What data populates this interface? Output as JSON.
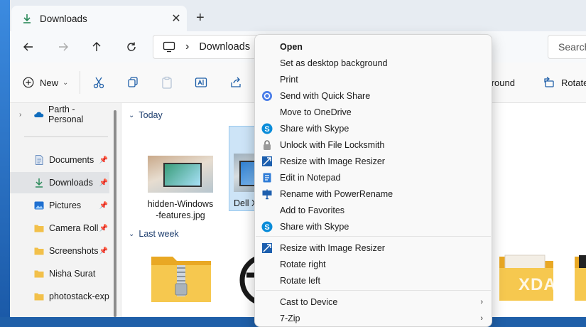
{
  "window": {
    "tab_title": "Downloads",
    "tab_close": "✕",
    "new_tab": "+"
  },
  "nav": {
    "location_label": "Downloads",
    "chevron": "›",
    "search_placeholder": "Search"
  },
  "toolbar": {
    "new_label": "New",
    "new_chevron": "⌄",
    "background_label": "kground",
    "rotate_label": "Rotate"
  },
  "sidebar": {
    "items": [
      {
        "label": "Parth - Personal",
        "icon": "onedrive-cloud-icon"
      },
      {
        "label": "Documents",
        "icon": "documents-icon",
        "pinned": true
      },
      {
        "label": "Downloads",
        "icon": "download-icon",
        "pinned": true,
        "selected": true
      },
      {
        "label": "Pictures",
        "icon": "pictures-icon",
        "pinned": true
      },
      {
        "label": "Camera Roll",
        "icon": "folder-icon",
        "pinned": true
      },
      {
        "label": "Screenshots",
        "icon": "folder-icon",
        "pinned": true
      },
      {
        "label": "Nisha Surat",
        "icon": "folder-icon"
      },
      {
        "label": "photostack-expo",
        "icon": "folder-icon"
      }
    ]
  },
  "content": {
    "group_today": "Today",
    "group_last_week": "Last week",
    "files": [
      {
        "name_line1": "hidden-Windows",
        "name_line2": "-features.jpg"
      },
      {
        "name_line1": "Dell XPS",
        "selected": true
      }
    ]
  },
  "context_menu": {
    "items": [
      {
        "label": "Open",
        "bold": true,
        "icon": ""
      },
      {
        "label": "Set as desktop background",
        "icon": ""
      },
      {
        "label": "Print",
        "icon": ""
      },
      {
        "label": "Send with Quick Share",
        "icon": "quick-share-icon"
      },
      {
        "label": "Move to OneDrive",
        "icon": ""
      },
      {
        "label": "Share with Skype",
        "icon": "skype-icon"
      },
      {
        "label": "Unlock with File Locksmith",
        "icon": "lock-icon"
      },
      {
        "label": "Resize with Image Resizer",
        "icon": "image-resizer-icon"
      },
      {
        "label": "Edit in Notepad",
        "icon": "notepad-icon"
      },
      {
        "label": "Rename with PowerRename",
        "icon": "powerrename-icon"
      },
      {
        "label": "Add to Favorites",
        "icon": ""
      },
      {
        "label": "Share with Skype",
        "icon": "skype-icon"
      },
      {
        "label": "Resize with Image Resizer",
        "icon": "image-resizer-icon"
      },
      {
        "label": "Rotate right",
        "icon": ""
      },
      {
        "label": "Rotate left",
        "icon": ""
      },
      {
        "label": "Cast to Device",
        "icon": "",
        "submenu": true
      },
      {
        "label": "7-Zip",
        "icon": "",
        "submenu": true
      }
    ],
    "submenu_arrow": "›"
  },
  "watermark": "XDA",
  "colors": {
    "accent": "#0067c0",
    "folder": "#f2c04a",
    "selection": "#cde4f7",
    "skype": "#0a8cd9"
  }
}
